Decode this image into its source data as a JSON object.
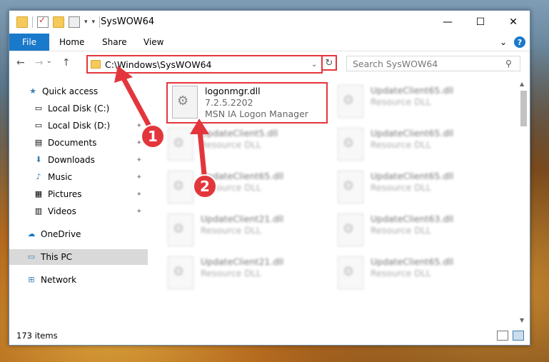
{
  "window": {
    "title": "SysWOW64",
    "controls": {
      "minimize": "—",
      "maximize": "☐",
      "close": "✕"
    }
  },
  "ribbon": {
    "tabs": [
      "File",
      "Home",
      "Share",
      "View"
    ],
    "expand": "⌄",
    "help": "?"
  },
  "nav": {
    "back": "←",
    "forward": "→",
    "recent": "⌄",
    "up": "↑"
  },
  "address": {
    "path": "C:\\Windows\\SysWOW64",
    "dropdown": "⌄",
    "refresh": "↻"
  },
  "search": {
    "placeholder": "Search SysWOW64",
    "icon": "search-icon"
  },
  "sidebar": {
    "items": [
      {
        "label": "Quick access",
        "icon": "star-icon",
        "glyph": "★",
        "color": "#3c7fb1"
      },
      {
        "label": "Local Disk (C:)",
        "icon": "drive-icon",
        "glyph": "▭",
        "pinned": true
      },
      {
        "label": "Local Disk (D:)",
        "icon": "drive-icon",
        "glyph": "▭",
        "pinned": true
      },
      {
        "label": "Documents",
        "icon": "document-icon",
        "glyph": "▤",
        "pinned": true
      },
      {
        "label": "Downloads",
        "icon": "download-icon",
        "glyph": "⬇",
        "pinned": true
      },
      {
        "label": "Music",
        "icon": "music-icon",
        "glyph": "♪",
        "pinned": true
      },
      {
        "label": "Pictures",
        "icon": "picture-icon",
        "glyph": "▦",
        "pinned": true
      },
      {
        "label": "Videos",
        "icon": "video-icon",
        "glyph": "▥",
        "pinned": true
      },
      {
        "label": "OneDrive",
        "icon": "cloud-icon",
        "glyph": "☁"
      },
      {
        "label": "This PC",
        "icon": "computer-icon",
        "glyph": "▭",
        "selected": true
      },
      {
        "label": "Network",
        "icon": "network-icon",
        "glyph": "⊞"
      }
    ],
    "pin_glyph": "📌"
  },
  "files": [
    {
      "name": "logonmgr.dll",
      "version": "7.2.5.2202",
      "description": "MSN IA Logon Manager",
      "highlighted": true
    },
    {
      "name": "UpdateClient65.dll",
      "description": "Resource DLL",
      "blurred": true
    },
    {
      "name": "UpdateClient5.dll",
      "description": "Resource DLL",
      "blurred": true
    },
    {
      "name": "UpdateClient65.dll",
      "description": "Resource DLL",
      "blurred": true
    },
    {
      "name": "UpdateClient65.dll",
      "description": "Resource DLL",
      "blurred": true
    },
    {
      "name": "UpdateClient65.dll",
      "description": "Resource DLL",
      "blurred": true
    },
    {
      "name": "UpdateClient21.dll",
      "description": "Resource DLL",
      "blurred": true
    },
    {
      "name": "UpdateClient63.dll",
      "description": "Resource DLL",
      "blurred": true
    },
    {
      "name": "UpdateClient21.dll",
      "description": "Resource DLL",
      "blurred": true
    },
    {
      "name": "UpdateClient65.dll",
      "description": "Resource DLL",
      "blurred": true
    }
  ],
  "status": {
    "count": "173 items"
  },
  "callouts": [
    "1",
    "2"
  ],
  "colors": {
    "accent": "#1979ca",
    "highlight": "#e3363c"
  }
}
